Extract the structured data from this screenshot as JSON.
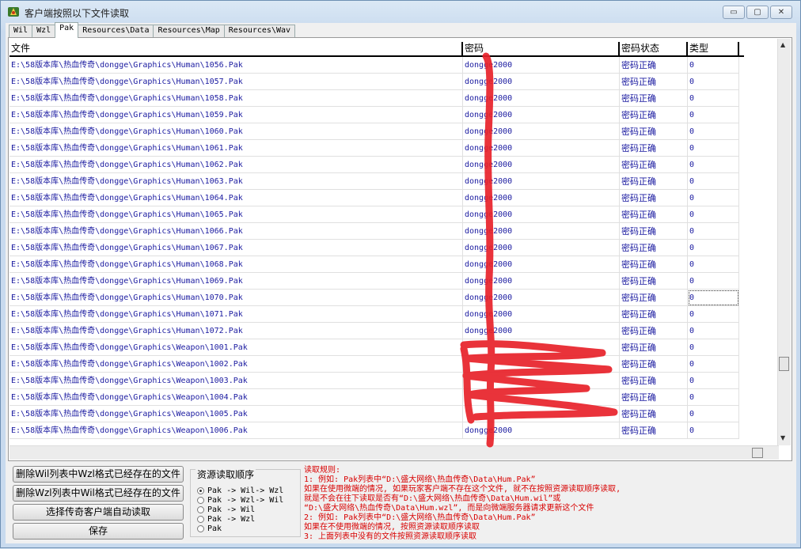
{
  "window": {
    "title": "客户端按照以下文件读取",
    "ctrl_min": "▭",
    "ctrl_max": "▢",
    "ctrl_close": "✕"
  },
  "tabs": [
    "Wil",
    "Wzl",
    "Pak",
    "Resources\\Data",
    "Resources\\Map",
    "Resources\\Wav"
  ],
  "active_tab": 2,
  "table": {
    "columns": [
      "文件",
      "密码",
      "密码状态",
      "类型"
    ],
    "rows": [
      [
        "E:\\58版本库\\热血传奇\\dongge\\Graphics\\Human\\1056.Pak",
        "dongge2000",
        "密码正确",
        "0"
      ],
      [
        "E:\\58版本库\\热血传奇\\dongge\\Graphics\\Human\\1057.Pak",
        "dongge2000",
        "密码正确",
        "0"
      ],
      [
        "E:\\58版本库\\热血传奇\\dongge\\Graphics\\Human\\1058.Pak",
        "dongge2000",
        "密码正确",
        "0"
      ],
      [
        "E:\\58版本库\\热血传奇\\dongge\\Graphics\\Human\\1059.Pak",
        "dongge2000",
        "密码正确",
        "0"
      ],
      [
        "E:\\58版本库\\热血传奇\\dongge\\Graphics\\Human\\1060.Pak",
        "dongge2000",
        "密码正确",
        "0"
      ],
      [
        "E:\\58版本库\\热血传奇\\dongge\\Graphics\\Human\\1061.Pak",
        "dongge2000",
        "密码正确",
        "0"
      ],
      [
        "E:\\58版本库\\热血传奇\\dongge\\Graphics\\Human\\1062.Pak",
        "dongge2000",
        "密码正确",
        "0"
      ],
      [
        "E:\\58版本库\\热血传奇\\dongge\\Graphics\\Human\\1063.Pak",
        "dongge2000",
        "密码正确",
        "0"
      ],
      [
        "E:\\58版本库\\热血传奇\\dongge\\Graphics\\Human\\1064.Pak",
        "dongge2000",
        "密码正确",
        "0"
      ],
      [
        "E:\\58版本库\\热血传奇\\dongge\\Graphics\\Human\\1065.Pak",
        "dongge2000",
        "密码正确",
        "0"
      ],
      [
        "E:\\58版本库\\热血传奇\\dongge\\Graphics\\Human\\1066.Pak",
        "dongge2000",
        "密码正确",
        "0"
      ],
      [
        "E:\\58版本库\\热血传奇\\dongge\\Graphics\\Human\\1067.Pak",
        "dongge2000",
        "密码正确",
        "0"
      ],
      [
        "E:\\58版本库\\热血传奇\\dongge\\Graphics\\Human\\1068.Pak",
        "dongge2000",
        "密码正确",
        "0"
      ],
      [
        "E:\\58版本库\\热血传奇\\dongge\\Graphics\\Human\\1069.Pak",
        "dongge2000",
        "密码正确",
        "0"
      ],
      [
        "E:\\58版本库\\热血传奇\\dongge\\Graphics\\Human\\1070.Pak",
        "dongge2000",
        "密码正确",
        "0"
      ],
      [
        "E:\\58版本库\\热血传奇\\dongge\\Graphics\\Human\\1071.Pak",
        "dongge2000",
        "密码正确",
        "0"
      ],
      [
        "E:\\58版本库\\热血传奇\\dongge\\Graphics\\Human\\1072.Pak",
        "dongge2000",
        "密码正确",
        "0"
      ],
      [
        "E:\\58版本库\\热血传奇\\dongge\\Graphics\\Weapon\\1001.Pak",
        "",
        "密码正确",
        "0"
      ],
      [
        "E:\\58版本库\\热血传奇\\dongge\\Graphics\\Weapon\\1002.Pak",
        "",
        "密码正确",
        "0"
      ],
      [
        "E:\\58版本库\\热血传奇\\dongge\\Graphics\\Weapon\\1003.Pak",
        "",
        "密码正确",
        "0"
      ],
      [
        "E:\\58版本库\\热血传奇\\dongge\\Graphics\\Weapon\\1004.Pak",
        "",
        "密码正确",
        "0"
      ],
      [
        "E:\\58版本库\\热血传奇\\dongge\\Graphics\\Weapon\\1005.Pak",
        "",
        "密码正确",
        "0"
      ],
      [
        "E:\\58版本库\\热血传奇\\dongge\\Graphics\\Weapon\\1006.Pak",
        "dongge2000",
        "密码正确",
        "0"
      ]
    ],
    "selected_row": 14
  },
  "buttons": {
    "delete_wil": "删除Wil列表中Wzl格式已经存在的文件",
    "delete_wzl": "删除Wzl列表中Wil格式已经存在的文件",
    "auto_read": "选择传奇客户端自动读取",
    "save": "保存"
  },
  "order": {
    "title": "资源读取顺序",
    "options": [
      "Pak -> Wil-> Wzl",
      "Pak -> Wzl-> Wil",
      "Pak -> Wil",
      "Pak -> Wzl",
      "Pak"
    ],
    "selected": 0
  },
  "rules": [
    "读取规则:",
    "1: 例如: Pak列表中“D:\\盛大网络\\热血传奇\\Data\\Hum.Pak”",
    "    如果在使用微端的情况, 如果玩家客户端不存在这个文件, 就不在按照资源读取顺序读取,",
    "    就是不会在往下读取是否有“D:\\盛大网络\\热血传奇\\Data\\Hum.wil”或",
    "  “D:\\盛大网络\\热血传奇\\Data\\Hum.wzl”, 而是向微端服务器请求更新这个文件",
    "2: 例如: Pak列表中“D:\\盛大网络\\热血传奇\\Data\\Hum.Pak”",
    "    如果在不使用微端的情况, 按照资源读取顺序读取",
    "3: 上面列表中没有的文件按照资源读取顺序读取"
  ],
  "colors": {
    "scribble": "#e8222a",
    "rules_text": "#d80000",
    "cell_text": "#1a1aa0"
  }
}
